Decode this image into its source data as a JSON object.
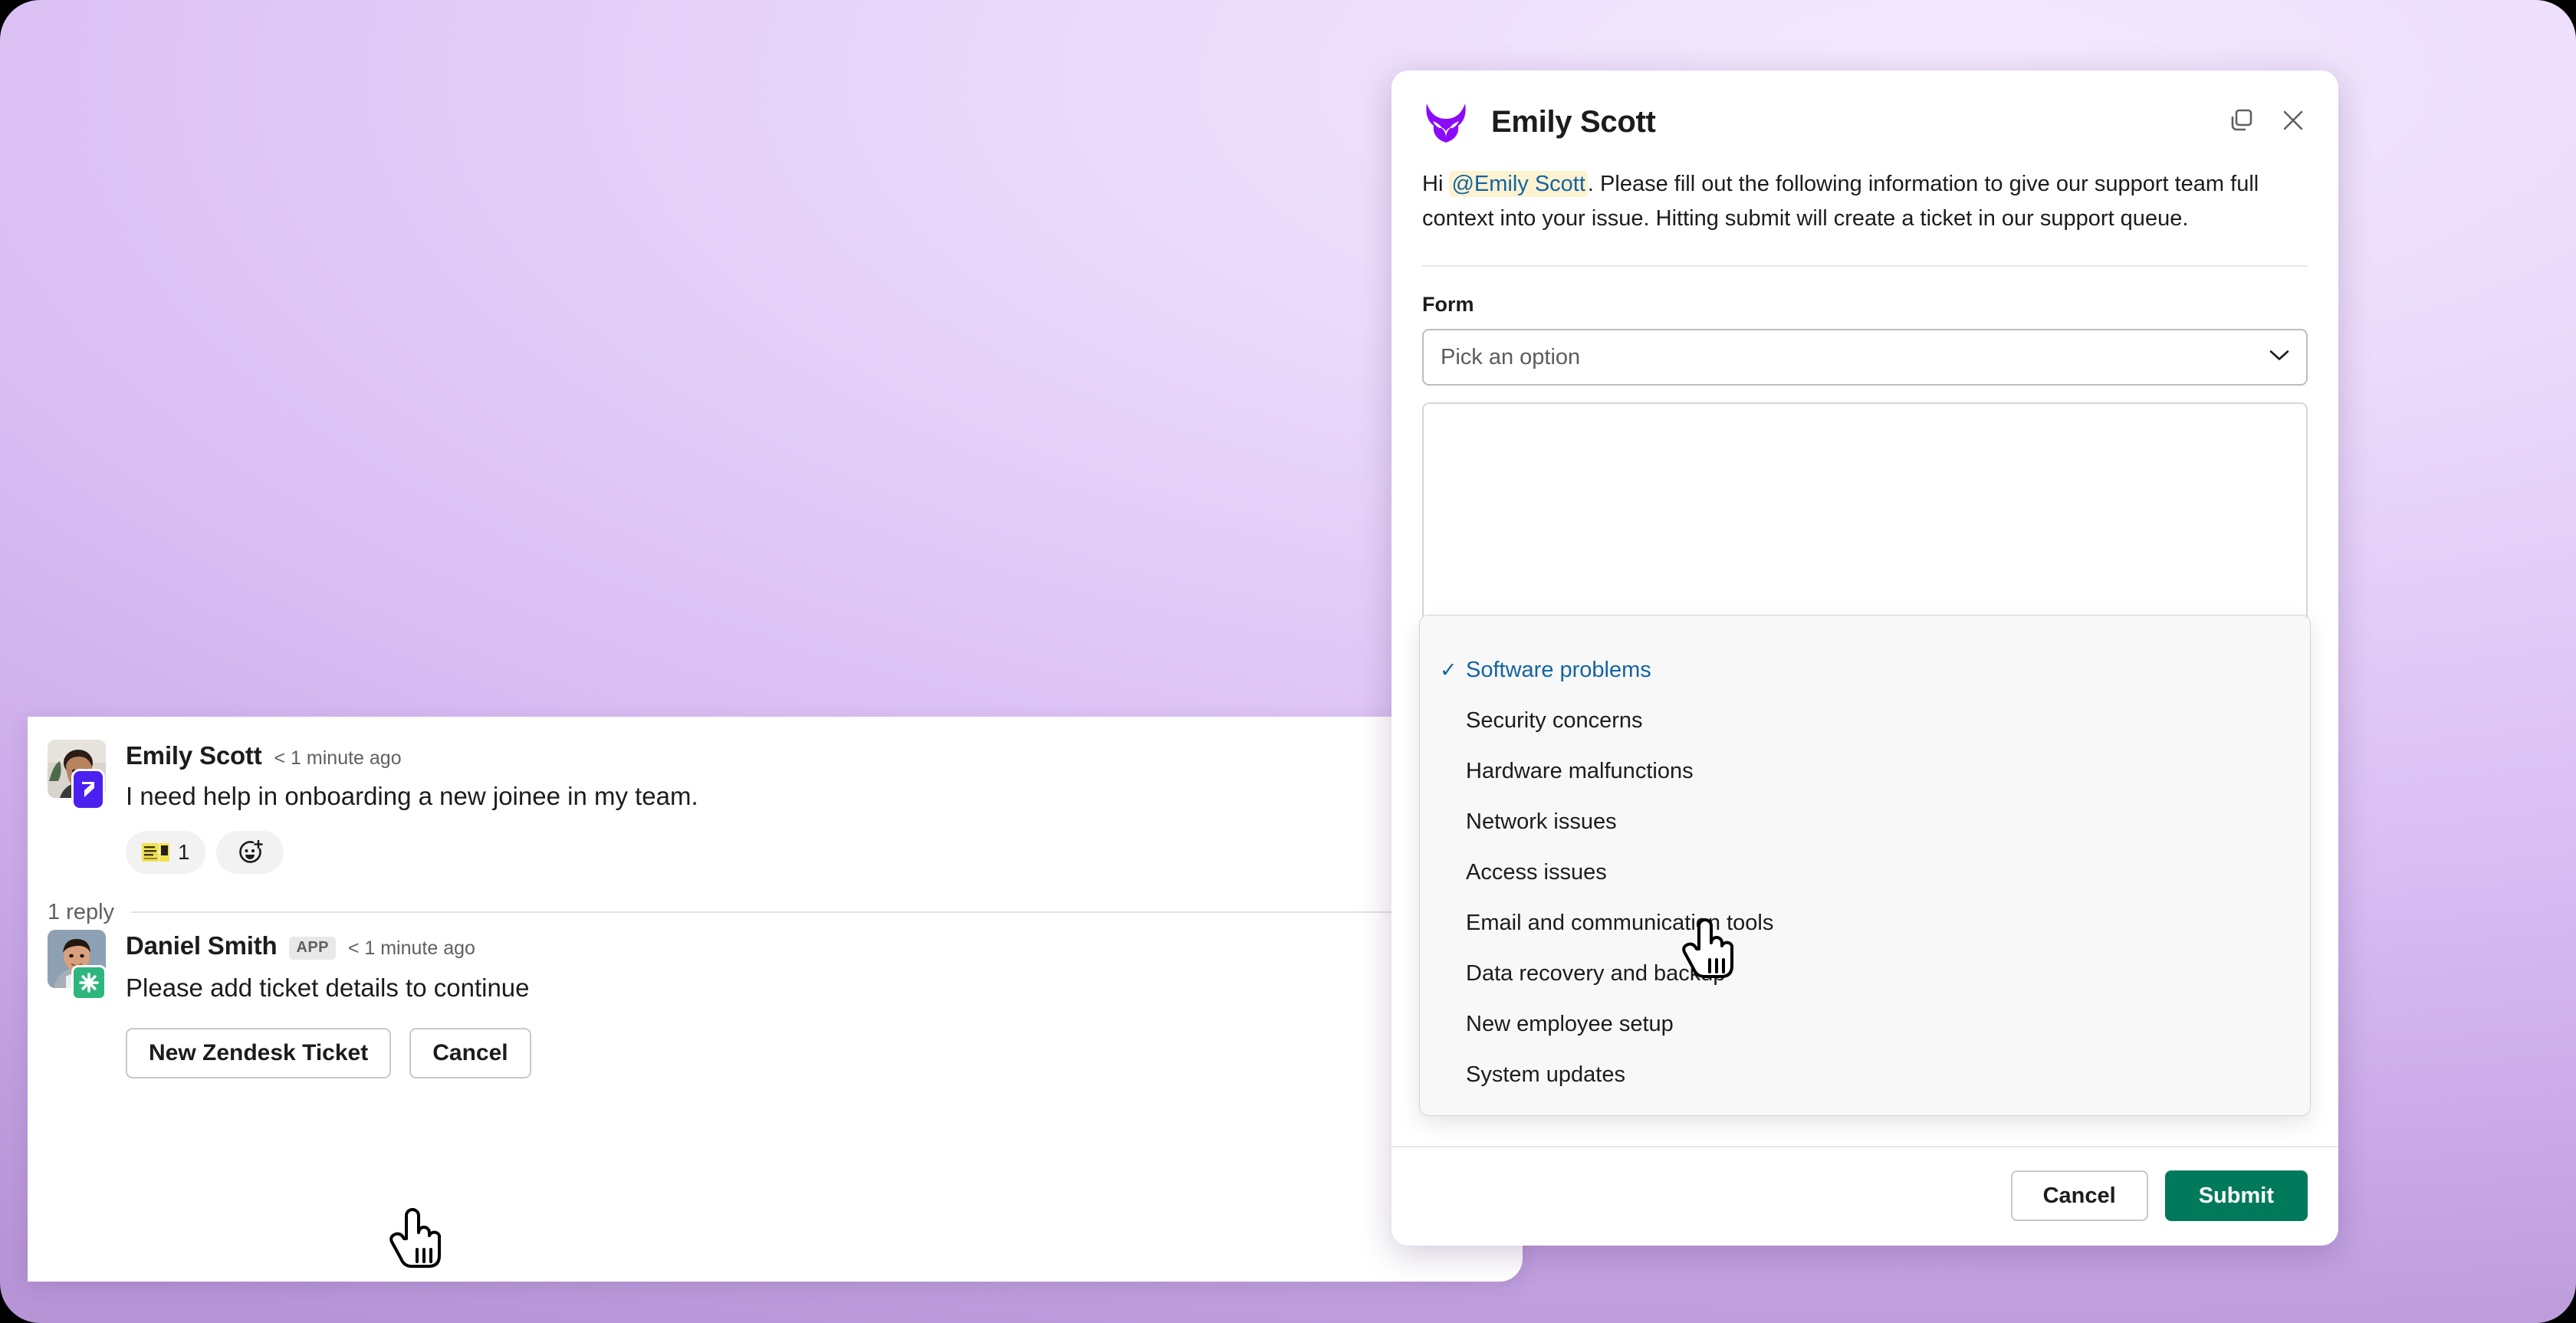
{
  "theme": {
    "accent_green": "#007a5a",
    "link_blue": "#1264a3",
    "mention_bg": "#fdf3d1",
    "slack_purple": "#4a21ef",
    "zendesk_green": "#2eb67d",
    "logo_purple": "#8a0bfa",
    "background_gradient_from": "#f3e9fd",
    "background_gradient_to": "#b694d6"
  },
  "thread": {
    "message": {
      "author": "Emily Scott",
      "timestamp": "< 1 minute ago",
      "text": "I need help in onboarding a new joinee in my team.",
      "avatar_icon": "emily-avatar",
      "badge_icon": "slack-badge-icon",
      "reactions": [
        {
          "emoji_icon": "ticket-emoji",
          "count": "1"
        }
      ],
      "add_reaction_icon": "add-reaction-icon"
    },
    "reply_count_label": "1 reply",
    "reply": {
      "author": "Daniel Smith",
      "app_badge": "APP",
      "timestamp": "< 1 minute ago",
      "text": "Please add ticket details to continue",
      "avatar_icon": "daniel-avatar",
      "badge_icon": "zendesk-badge-icon"
    },
    "actions": [
      {
        "label": "New Zendesk Ticket",
        "name": "new-zendesk-ticket-button"
      },
      {
        "label": "Cancel",
        "name": "thread-cancel-button"
      }
    ]
  },
  "modal": {
    "logo_icon": "owl-logo-icon",
    "title": "Emily Scott",
    "copy_icon": "copy-icon",
    "close_icon": "close-icon",
    "intro": {
      "greeting": "Hi ",
      "mention": "@Emily Scott",
      "rest": ". Please fill out the following information to give our support team full context into your issue. Hitting submit will create a ticket in our support queue."
    },
    "form": {
      "label": "Form",
      "select": {
        "placeholder": "Pick an option",
        "chevron_icon": "chevron-down-icon",
        "selected": "Software problems",
        "options": [
          "Software problems",
          "Security concerns",
          "Hardware malfunctions",
          "Network issues",
          "Access issues",
          "Email and communication tools",
          "Data recovery and backup",
          "New employee setup",
          "System updates"
        ]
      },
      "textarea": {
        "value": "",
        "placeholder": ""
      }
    },
    "footer": {
      "cancel_label": "Cancel",
      "submit_label": "Submit"
    }
  },
  "cursors": [
    {
      "name": "cursor-dropdown",
      "icon": "pointing-hand-cursor"
    },
    {
      "name": "cursor-button",
      "icon": "pointing-hand-cursor"
    }
  ]
}
